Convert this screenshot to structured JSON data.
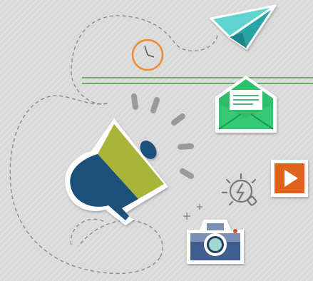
{
  "scene": {
    "description_icons": [
      "paper-plane-icon",
      "clock-icon",
      "envelope-icon",
      "megaphone-icon",
      "lightbulb-icon",
      "play-button-icon",
      "camera-icon"
    ],
    "colors": {
      "background": "#d9d9d9",
      "texture_line": "#e8e8e8",
      "dashed_path": "#8a8a8a",
      "plane_light": "#5ed3d0",
      "plane_dark": "#2aa3a6",
      "clock": "#f08a2c",
      "green_line": "#4a9a3c",
      "envelope": "#2fbf6b",
      "envelope_dark": "#1f9a52",
      "megaphone_blue": "#1f4f7a",
      "megaphone_olive": "#a9b43a",
      "rays": "#9a9a9a",
      "play_orange": "#e0621e",
      "camera_body": "#3f5f8f",
      "camera_top": "#7b8fb5",
      "camera_lens": "#9ed9d2",
      "camera_red": "#e0452b",
      "bulb": "#777777"
    }
  }
}
